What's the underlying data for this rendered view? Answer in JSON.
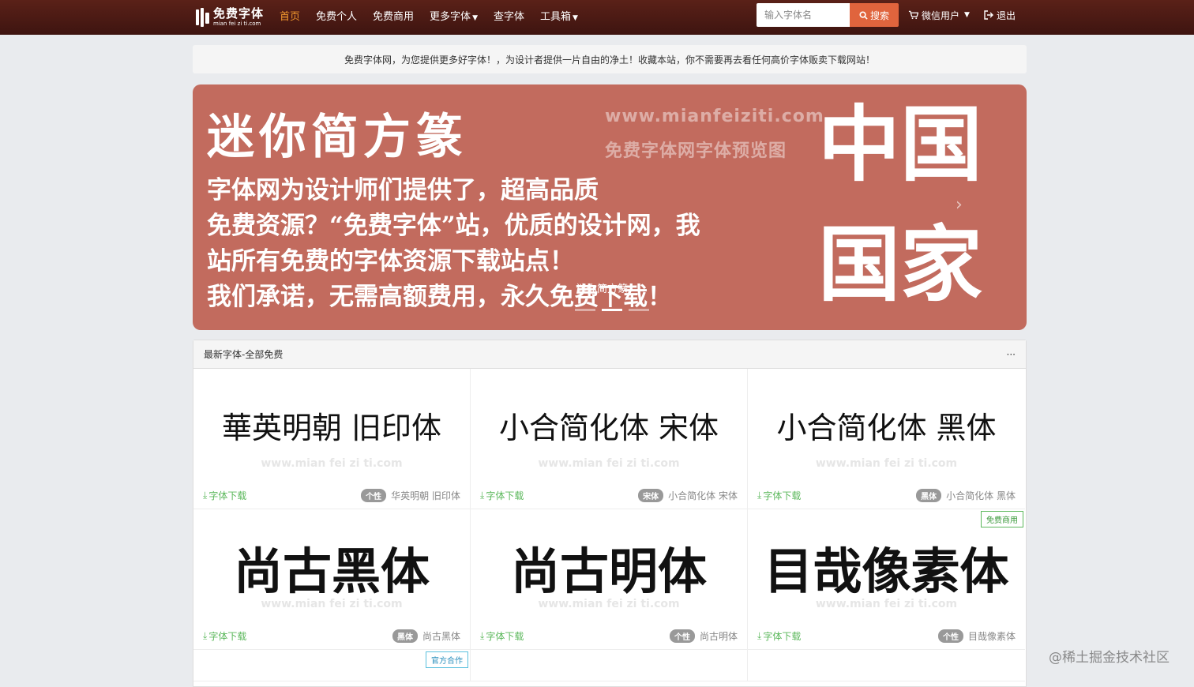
{
  "brand": {
    "title": "免费字体",
    "subtitle": "mian fei zi ti.com"
  },
  "nav": [
    {
      "label": "首页",
      "active": true,
      "dropdown": false
    },
    {
      "label": "免费个人",
      "active": false,
      "dropdown": false
    },
    {
      "label": "免费商用",
      "active": false,
      "dropdown": false
    },
    {
      "label": "更多字体",
      "active": false,
      "dropdown": true
    },
    {
      "label": "查字体",
      "active": false,
      "dropdown": false
    },
    {
      "label": "工具箱",
      "active": false,
      "dropdown": true
    }
  ],
  "search": {
    "placeholder": "输入字体名",
    "button_label": "搜索"
  },
  "user": {
    "name": "微信用户",
    "logout": "退出"
  },
  "notice": "免费字体网，为您提供更多好字体！，为设计者提供一片自由的净土！收藏本站，你不需要再去看任何高价字体贩卖下载网站！",
  "banner": {
    "title": "迷你简方篆",
    "lines": [
      "字体网为设计师们提供了，超高品质",
      "免费资源？“免费字体”站，优质的设计网，我",
      "站所有免费的字体资源下载站点！",
      "我们承诺，无需高额费用，永久免费下载！"
    ],
    "watermark_url": "www.mianfeiziti.com",
    "watermark_sub": "免费字体网字体预览图",
    "big_top": "中国",
    "big_bottom": "国家",
    "caption": "迷你简方篆",
    "arrow": "›",
    "slides": 3,
    "active_slide": 2
  },
  "panel": {
    "title": "最新字体-全部免费",
    "more": "···",
    "download_label": "字体下载",
    "watermark": "www.mian fei zi ti.com",
    "fonts": [
      {
        "preview": "華英明朝 旧印体",
        "badge": "个性",
        "name": "华英明朝 旧印体",
        "style": "serif",
        "tag": ""
      },
      {
        "preview": "小合简化体 宋体",
        "badge": "宋体",
        "name": "小合简化体 宋体",
        "style": "serif",
        "tag": ""
      },
      {
        "preview": "小合简化体 黑体",
        "badge": "黑体",
        "name": "小合简化体 黑体",
        "style": "sans",
        "tag": ""
      },
      {
        "preview": "尚古黑体",
        "badge": "黑体",
        "name": "尚古黑体",
        "style": "bold",
        "tag": ""
      },
      {
        "preview": "尚古明体",
        "badge": "个性",
        "name": "尚古明体",
        "style": "bold-serif",
        "tag": ""
      },
      {
        "preview": "目哉像素体",
        "badge": "个性",
        "name": "目哉像素体",
        "style": "bold",
        "tag": "免费商用"
      }
    ],
    "row3_tag": "官方合作"
  },
  "credit": "@稀土掘金技术社区",
  "colors": {
    "nav_bg": "#4a1a13",
    "active": "#f2992e",
    "search_btn": "#e0643d",
    "banner_bg": "#c26b5e",
    "download": "#5cb85c"
  }
}
